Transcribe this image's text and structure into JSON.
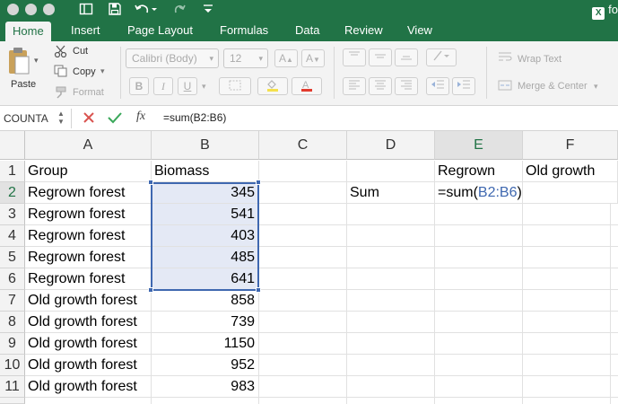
{
  "titlebar": {
    "doc_title": "fo",
    "excel_badge": "X"
  },
  "tabs": [
    {
      "label": "Home",
      "active": true
    },
    {
      "label": "Insert"
    },
    {
      "label": "Page Layout"
    },
    {
      "label": "Formulas"
    },
    {
      "label": "Data"
    },
    {
      "label": "Review"
    },
    {
      "label": "View"
    }
  ],
  "ribbon": {
    "paste_label": "Paste",
    "cut_label": "Cut",
    "copy_label": "Copy",
    "format_label": "Format",
    "font_name": "Calibri (Body)",
    "font_size": "12",
    "wrap_text_label": "Wrap Text",
    "merge_center_label": "Merge & Center"
  },
  "formula_bar": {
    "name_box": "COUNTA",
    "fx_label": "fx",
    "formula": "=sum(B2:B6)"
  },
  "grid": {
    "columns": [
      "A",
      "B",
      "C",
      "D",
      "E",
      "F"
    ],
    "rows": [
      "1",
      "2",
      "3",
      "4",
      "5",
      "6",
      "7",
      "8",
      "9",
      "10",
      "11"
    ],
    "col_a": [
      "Group",
      "Regrown forest",
      "Regrown forest",
      "Regrown forest",
      "Regrown forest",
      "Regrown forest",
      "Old growth forest",
      "Old growth forest",
      "Old growth forest",
      "Old growth forest",
      "Old growth forest"
    ],
    "col_b": [
      "Biomass",
      "345",
      "541",
      "403",
      "485",
      "641",
      "858",
      "739",
      "1150",
      "952",
      "983"
    ],
    "d2": "Sum",
    "e1": "Regrown",
    "f1": "Old growth",
    "e2_prefix": "=sum(",
    "e2_ref": "B2:B6",
    "e2_suffix": ")"
  },
  "colors": {
    "accent": "#217346",
    "selection": "#3f68b0",
    "selection_fill": "#e4e9f5"
  }
}
